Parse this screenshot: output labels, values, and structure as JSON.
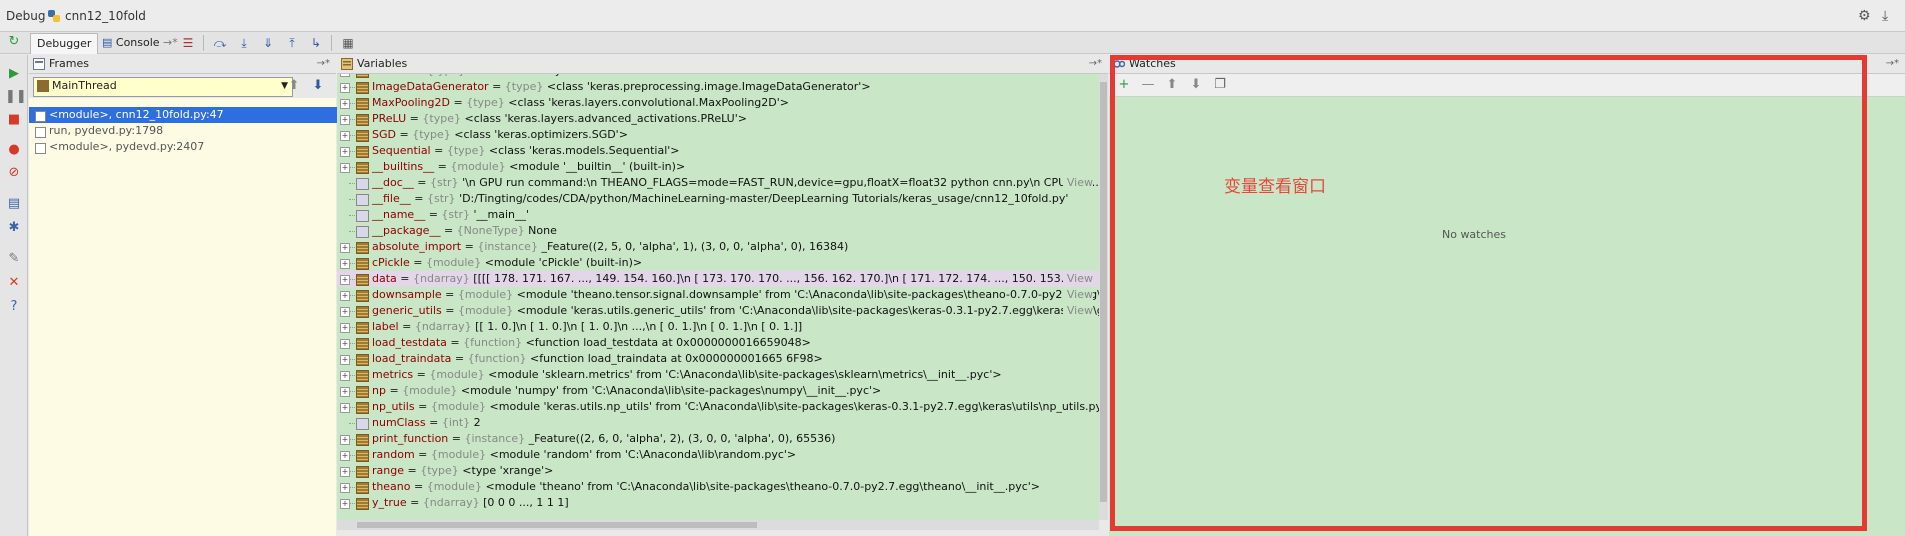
{
  "titlebar": {
    "title": "Debug",
    "config_name": "cnn12_10fold"
  },
  "tabs": {
    "debugger": "Debugger",
    "console": "Console"
  },
  "frames": {
    "title": "Frames",
    "thread": "MainThread",
    "items": [
      "<module>, cnn12_10fold.py:47",
      "run, pydevd.py:1798",
      "<module>, pydevd.py:2407"
    ]
  },
  "variables": {
    "title": "Variables",
    "view_label": "View",
    "rows": [
      {
        "n": "Flatten",
        "t": "{type}",
        "v": "<class 'keras.layers.core.Flatten'>"
      },
      {
        "n": "ImageDataGenerator",
        "t": "{type}",
        "v": "<class 'keras.preprocessing.image.ImageDataGenerator'>"
      },
      {
        "n": "MaxPooling2D",
        "t": "{type}",
        "v": "<class 'keras.layers.convolutional.MaxPooling2D'>"
      },
      {
        "n": "PReLU",
        "t": "{type}",
        "v": "<class 'keras.layers.advanced_activations.PReLU'>"
      },
      {
        "n": "SGD",
        "t": "{type}",
        "v": "<class 'keras.optimizers.SGD'>"
      },
      {
        "n": "Sequential",
        "t": "{type}",
        "v": "<class 'keras.models.Sequential'>"
      },
      {
        "n": "__builtins__",
        "t": "{module}",
        "v": "<module '__builtin__' (built-in)>"
      },
      {
        "n": "__doc__",
        "t": "{str}",
        "v": "'\\n    GPU run command:\\n        THEANO_FLAGS=mode=FAST_RUN,device=gpu,floatX=float32 python cnn.py\\n    CPU run …"
      },
      {
        "n": "__file__",
        "t": "{str}",
        "v": "'D:/Tingting/codes/CDA/python/MachineLearning-master/DeepLearning Tutorials/keras_usage/cnn12_10fold.py'"
      },
      {
        "n": "__name__",
        "t": "{str}",
        "v": "'__main__'"
      },
      {
        "n": "__package__",
        "t": "{NoneType}",
        "v": "None"
      },
      {
        "n": "absolute_import",
        "t": "{instance}",
        "v": "_Feature((2, 5, 0, 'alpha', 1), (3, 0, 0, 'alpha', 0), 16384)"
      },
      {
        "n": "cPickle",
        "t": "{module}",
        "v": "<module 'cPickle' (built-in)>"
      },
      {
        "n": "data",
        "t": "{ndarray}",
        "v": "[[[[ 178.  171.  167. ...,  149.  154.  160.]\\n  [ 173.  170.  170. ...,  156.  162.  170.]\\n  [ 171.  172.  174. ...,  150.  153."
      },
      {
        "n": "downsample",
        "t": "{module}",
        "v": "<module 'theano.tensor.signal.downsample' from 'C:\\Anaconda\\lib\\site-packages\\theano-0.7.0-py2.7.egg\\theano\\te"
      },
      {
        "n": "generic_utils",
        "t": "{module}",
        "v": "<module 'keras.utils.generic_utils' from 'C:\\Anaconda\\lib\\site-packages\\keras-0.3.1-py2.7.egg\\keras\\utils\\generic_ut"
      },
      {
        "n": "label",
        "t": "{ndarray}",
        "v": "[[ 1.  0.]\\n [ 1.  0.]\\n [ 1.  0.]\\n ...,\\n [ 0.  1.]\\n [ 0.  1.]\\n [ 0.  1.]]"
      },
      {
        "n": "load_testdata",
        "t": "{function}",
        "v": "<function load_testdata at 0x0000000016659048>"
      },
      {
        "n": "load_traindata",
        "t": "{function}",
        "v": "<function load_traindata at 0x000000001665 6F98>"
      },
      {
        "n": "metrics",
        "t": "{module}",
        "v": "<module 'sklearn.metrics' from 'C:\\Anaconda\\lib\\site-packages\\sklearn\\metrics\\__init__.pyc'>"
      },
      {
        "n": "np",
        "t": "{module}",
        "v": "<module 'numpy' from 'C:\\Anaconda\\lib\\site-packages\\numpy\\__init__.pyc'>"
      },
      {
        "n": "np_utils",
        "t": "{module}",
        "v": "<module 'keras.utils.np_utils' from 'C:\\Anaconda\\lib\\site-packages\\keras-0.3.1-py2.7.egg\\keras\\utils\\np_utils.pyc'>"
      },
      {
        "n": "numClass",
        "t": "{int}",
        "v": "2"
      },
      {
        "n": "print_function",
        "t": "{instance}",
        "v": "_Feature((2, 6, 0, 'alpha', 2), (3, 0, 0, 'alpha', 0), 65536)"
      },
      {
        "n": "random",
        "t": "{module}",
        "v": "<module 'random' from 'C:\\Anaconda\\lib\\random.pyc'>"
      },
      {
        "n": "range",
        "t": "{type}",
        "v": "<type 'xrange'>"
      },
      {
        "n": "theano",
        "t": "{module}",
        "v": "<module 'theano' from 'C:\\Anaconda\\lib\\site-packages\\theano-0.7.0-py2.7.egg\\theano\\__init__.pyc'>"
      },
      {
        "n": "y_true",
        "t": "{ndarray}",
        "v": "[0 0 0 ..., 1 1 1]"
      }
    ]
  },
  "watches": {
    "title": "Watches",
    "empty_text": "No watches",
    "annotation": "变量查看窗口"
  },
  "colors": {
    "panel_green": "#c9e7c6",
    "annotation_red": "#e53a34",
    "selection_blue": "#2d6fe0"
  }
}
